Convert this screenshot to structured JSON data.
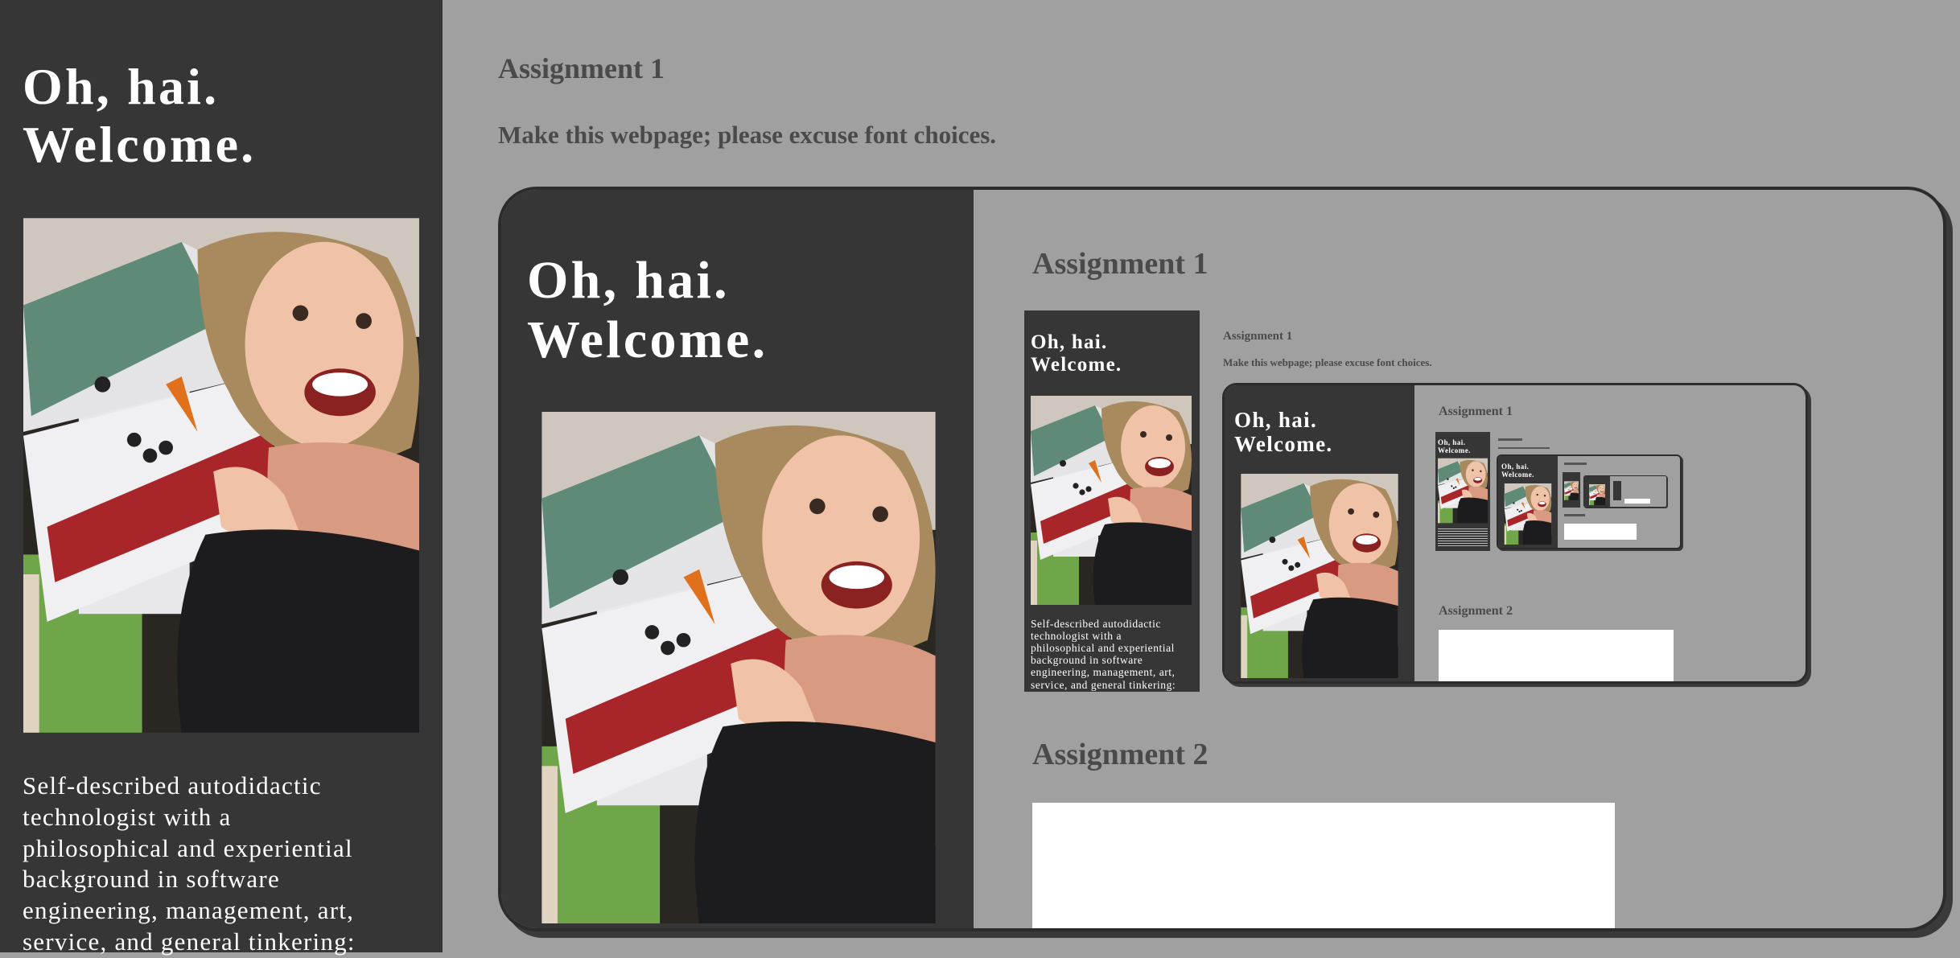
{
  "sidebar": {
    "greeting_line1": "Oh, hai.",
    "greeting_line2": "Welcome.",
    "bio_lines": [
      "Self-described autodidactic",
      "technologist with a",
      "philosophical and experiential",
      "background in software",
      "engineering, management, art,",
      "service, and general tinkering:"
    ],
    "photo_icon": "selfie-with-snowman-photo"
  },
  "main": {
    "assignment1_title": "Assignment 1",
    "assignment1_desc": "Make this webpage; please excuse font choices.",
    "assignment2_title": "Assignment 2"
  },
  "colors": {
    "page_bg": "#a0a0a0",
    "sidebar_bg": "#363636",
    "heading_text": "#4a4a4a",
    "white": "#ffffff"
  }
}
